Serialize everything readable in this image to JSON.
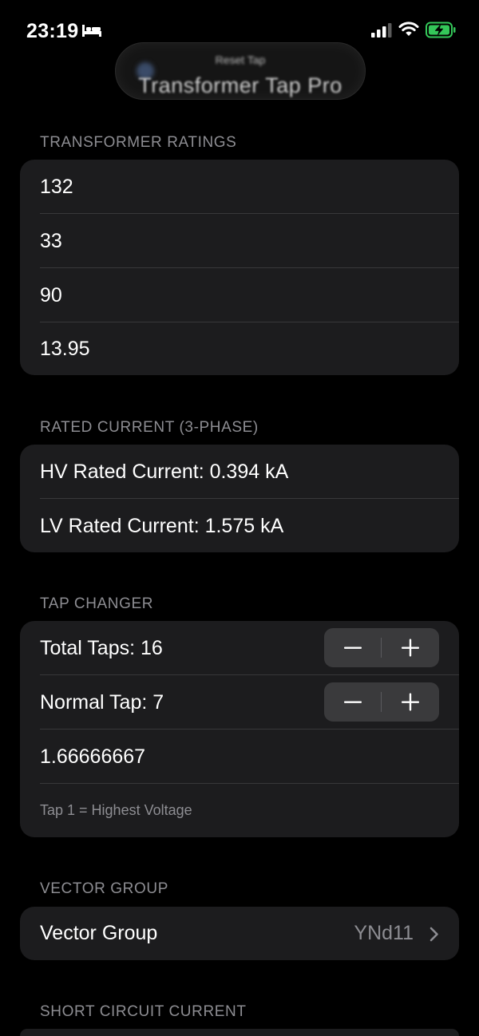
{
  "status_bar": {
    "time": "23:19"
  },
  "nav": {
    "subtitle": "Reset Tap",
    "title": "Transformer Tap Pro"
  },
  "sections": {
    "ratings": {
      "header": "TRANSFORMER RATINGS",
      "fields": [
        "132",
        "33",
        "90",
        "13.95"
      ]
    },
    "rated_current": {
      "header": "RATED CURRENT (3-PHASE)",
      "hv": "HV Rated Current: 0.394 kA",
      "lv": "LV Rated Current: 1.575 kA"
    },
    "tap_changer": {
      "header": "TAP CHANGER",
      "total_taps": "Total Taps: 16",
      "normal_tap": "Normal Tap: 7",
      "step_value": "1.66666667",
      "note": "Tap 1 = Highest Voltage"
    },
    "vector_group": {
      "header": "VECTOR GROUP",
      "label": "Vector Group",
      "value": "YNd11"
    },
    "short_circuit": {
      "header": "SHORT CIRCUIT CURRENT"
    }
  },
  "icons": {
    "bed": "bed-icon",
    "signal": "cellular-signal-icon",
    "wifi": "wifi-icon",
    "battery": "battery-charging-icon",
    "minus": "minus-icon",
    "plus": "plus-icon",
    "chevron": "chevron-right-icon"
  },
  "colors": {
    "battery": "#34c759",
    "background": "#000000",
    "card": "#1c1c1e",
    "secondary_text": "#8d8d92"
  }
}
